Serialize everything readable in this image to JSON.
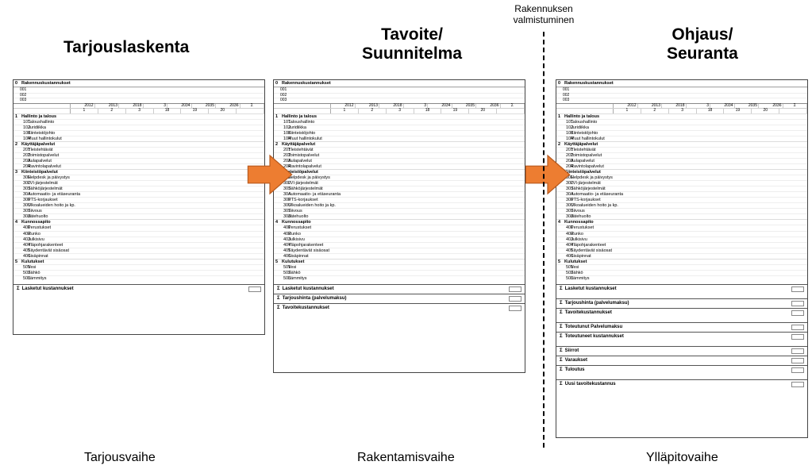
{
  "labels": {
    "valmistuminen_l1": "Rakennuksen",
    "valmistuminen_l2": "valmistuminen"
  },
  "titles": {
    "col1": "Tarjouslaskenta",
    "col2_l1": "Tavoite/",
    "col2_l2": "Suunnitelma",
    "col3_l1": "Ohjaus/",
    "col3_l2": "Seuranta"
  },
  "phases": {
    "p1": "Tarjousvaihe",
    "p2": "Rakentamisvaihe",
    "p3": "Ylläpitovaihe"
  },
  "sheet": {
    "header": "Rakennuskustannukset",
    "subheads": [
      "001",
      "002",
      "003"
    ],
    "cols1": [
      "2012",
      "2013",
      "2018",
      "3",
      "2034",
      "2035",
      "2036"
    ],
    "cols2": [
      "1",
      "2",
      "3",
      "18",
      "19",
      "20"
    ],
    "sections": [
      {
        "num": "1",
        "title": "Hallinto ja talous",
        "items": [
          {
            "code": "101",
            "label": "Taloushallinto"
          },
          {
            "code": "102",
            "label": "Juridiikka"
          },
          {
            "code": "103",
            "label": "Kiinteistöjohto"
          },
          {
            "code": "104",
            "label": "Muut hallintokulut"
          }
        ]
      },
      {
        "num": "2",
        "title": "Käyttäjäpalvelut",
        "items": [
          {
            "code": "201",
            "label": "Yleistehtävät"
          },
          {
            "code": "202",
            "label": "Toimistopalvelut"
          },
          {
            "code": "203",
            "label": "Aulapalvelut"
          },
          {
            "code": "204",
            "label": "Ravintolapalvelut"
          }
        ]
      },
      {
        "num": "3",
        "title": "Kiinteistöpalvelut",
        "items": [
          {
            "code": "301",
            "label": "Helpdesk ja päivystys"
          },
          {
            "code": "302",
            "label": "LVI-järjestelmät"
          },
          {
            "code": "303",
            "label": "Sähköjärjestelmät"
          },
          {
            "code": "304",
            "label": "Automaatio- ja etäseuranta"
          },
          {
            "code": "305",
            "label": "PTS-korjaukset"
          },
          {
            "code": "306",
            "label": "Ulkoalueiden hoito ja kp."
          },
          {
            "code": "307",
            "label": "Siivous"
          },
          {
            "code": "308",
            "label": "Jätehuolto"
          }
        ]
      },
      {
        "num": "4",
        "title": "Kunnossapito",
        "items": [
          {
            "code": "401",
            "label": "Perustukset"
          },
          {
            "code": "402",
            "label": "Runko"
          },
          {
            "code": "403",
            "label": "Julkisivu"
          },
          {
            "code": "404",
            "label": "Yläpohjarakenteet"
          },
          {
            "code": "405",
            "label": "Täydentävät sisäosat"
          },
          {
            "code": "406",
            "label": "Sisäpinnat"
          }
        ]
      },
      {
        "num": "5",
        "title": "Kulutukset",
        "items": [
          {
            "code": "501",
            "label": "Vesi"
          },
          {
            "code": "502",
            "label": "Sähkö"
          },
          {
            "code": "503",
            "label": "Lämmitys"
          }
        ]
      }
    ]
  },
  "summaries": {
    "s1": [
      "Lasketut kustannukset"
    ],
    "s2": [
      "Lasketut kustannukset",
      "Tarjoushinta (palvelumaksu)",
      "Tavoitekustannukset"
    ],
    "s3": [
      [
        "Lasketut kustannukset"
      ],
      [
        "Tarjoushinta (palvelumaksu)",
        "Tavoitekustannukset"
      ],
      [
        "Toteutunut Palvelumaksu",
        "Toteutuneet kustannukset"
      ],
      [
        "Siirrot",
        "Varaukset",
        "Tuloutus"
      ],
      [
        "Uusi tavoitekustannus"
      ]
    ]
  }
}
